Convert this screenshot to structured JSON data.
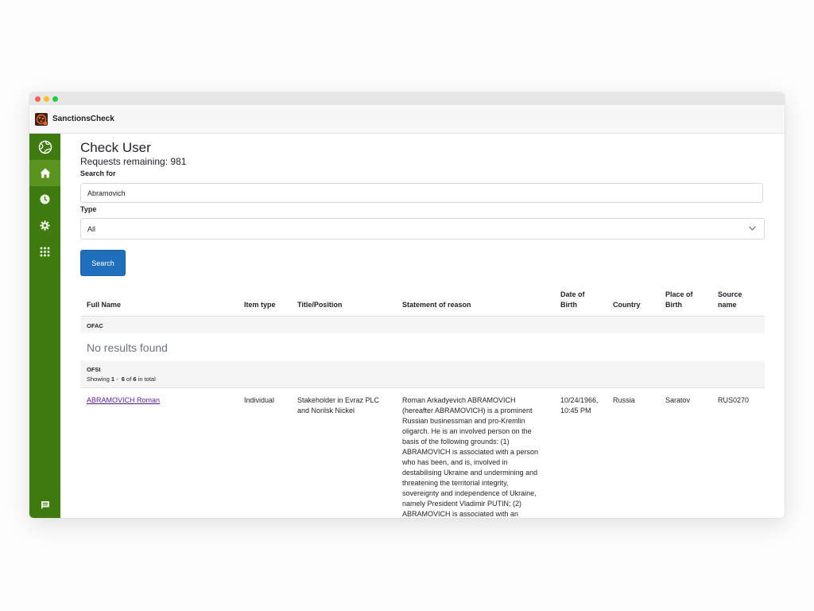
{
  "app": {
    "name": "SanctionsCheck"
  },
  "sidebar": {
    "items": [
      {
        "icon": "logo-globe-icon"
      },
      {
        "icon": "home-icon",
        "active": true
      },
      {
        "icon": "clock-icon"
      },
      {
        "icon": "gear-icon"
      },
      {
        "icon": "apps-grid-icon"
      }
    ],
    "bottom_icon": "chat-icon"
  },
  "page": {
    "title": "Check User",
    "remaining": "Requests remaining: 981",
    "search_label": "Search for",
    "search_value": "Abramovich",
    "type_label": "Type",
    "type_value": "All",
    "search_button": "Search"
  },
  "table": {
    "headers": {
      "full_name": "Full Name",
      "item_type": "Item type",
      "title": "Title/Position",
      "statement": "Statement of reason",
      "dob_1": "Date of",
      "dob_2": "Birth",
      "country": "Country",
      "pob_1": "Place of",
      "pob_2": "Birth",
      "source_1": "Source",
      "source_2": "name"
    },
    "ofac": {
      "label": "OFAC",
      "no_results": "No results found"
    },
    "ofsi": {
      "label": "OFSI",
      "showing_prefix": "Showing ",
      "showing_from": "1",
      "showing_mid": " -  ",
      "showing_to": "6",
      "showing_of": " of ",
      "showing_total": "6",
      "showing_suffix": " in total"
    },
    "rows": [
      {
        "name": "ABRAMOVICH Roman",
        "item_type": "Individual",
        "title_1": "Stakeholder in Evraz PLC",
        "title_2": "and Norilsk Nickel",
        "statement_lines": [
          "Roman Arkadyevich ABRAMOVICH",
          "(hereafter ABRAMOVICH) is a prominent",
          "Russian businessman and pro-Kremlin",
          "oligarch. He is an involved person on the",
          "basis of the following grounds: (1)",
          "ABRAMOVICH is associated with a person",
          "who has been, and is, involved in",
          "destabilising Ukraine and undermining and",
          "threatening the territorial integrity,",
          "sovereignty and independence of Ukraine,",
          "namely President Vladimir PUTIN; (2)",
          "ABRAMOVICH is associated with an"
        ],
        "dob_1": "10/24/1966,",
        "dob_2": "10:45 PM",
        "country": "Russia",
        "place_of_birth": "Saratov",
        "source": "RUS0270"
      }
    ]
  }
}
